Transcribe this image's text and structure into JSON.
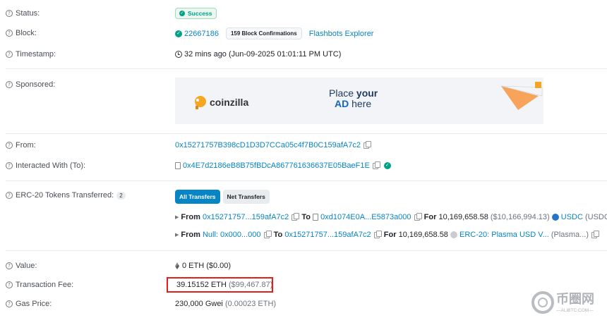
{
  "status": {
    "label": "Status:",
    "badge": "Success"
  },
  "block": {
    "label": "Block:",
    "number": "22667186",
    "confirmations": "159 Block Confirmations",
    "explorer": "Flashbots Explorer"
  },
  "timestamp": {
    "label": "Timestamp:",
    "value": "32 mins ago (Jun-09-2025 01:01:11 PM UTC)"
  },
  "sponsored": {
    "label": "Sponsored:",
    "ad_brand": "coinzilla",
    "ad_line1_a": "Place ",
    "ad_line1_b": "your",
    "ad_line2_a": "AD",
    "ad_line2_b": " here"
  },
  "from": {
    "label": "From:",
    "address": "0x15271757B398cD1D3D7CCa05c4f7B0C159afA7c2"
  },
  "interacted": {
    "label": "Interacted With (To):",
    "address": "0x4E7d2186eB8B75fBDcA867761636637E05BaeF1E"
  },
  "erc20": {
    "label": "ERC-20 Tokens Transferred:",
    "count": "2",
    "tabs": [
      "All Transfers",
      "Net Transfers"
    ],
    "transfers": [
      {
        "from_word": "From",
        "from": "0x15271757...159afA7c2",
        "to_word": "To",
        "to": "0xd1074E0A...E5873a000",
        "for_word": "For",
        "amount": "10,169,658.58",
        "usd": "($10,166,994.13)",
        "token": "USDC",
        "token_sym": "(USDC)"
      },
      {
        "from_word": "From",
        "from": "Null: 0x000...000",
        "to_word": "To",
        "to": "0x15271757...159afA7c2",
        "for_word": "For",
        "amount": "10,169,658.58",
        "token": "ERC-20: Plasma USD V...",
        "token_sym": "(Plasma...)"
      }
    ]
  },
  "value": {
    "label": "Value:",
    "value": "0 ETH ($0.00)"
  },
  "fee": {
    "label": "Transaction Fee:",
    "eth": "39.15152 ETH",
    "usd": "($99,467.87)"
  },
  "gas": {
    "label": "Gas Price:",
    "gwei": "230,000 Gwei",
    "eth": "(0.00023 ETH)"
  },
  "watermark": {
    "cn": "币圈网",
    "site": "—ALIBTC.COM—"
  },
  "colors": {
    "link": "#0784c3",
    "success": "#00a186",
    "highlight": "#e0201b"
  }
}
